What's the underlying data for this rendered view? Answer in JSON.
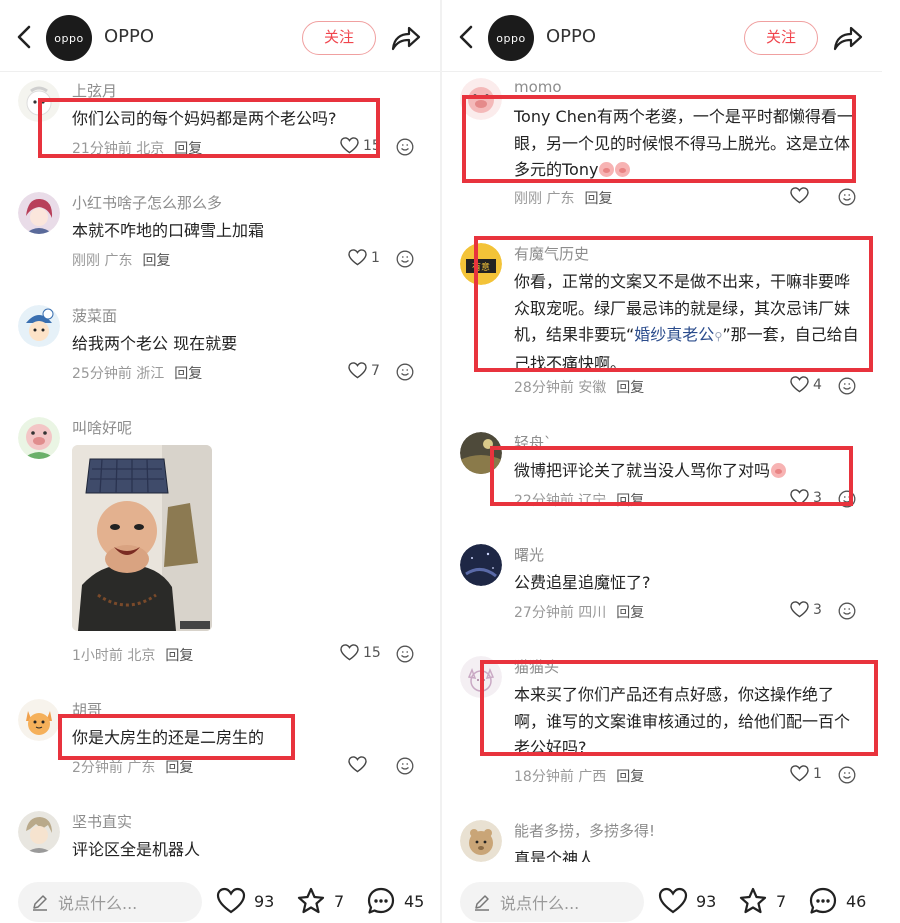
{
  "left": {
    "header": {
      "brand_logo_text": "oppo",
      "brand_name": "OPPO",
      "follow_label": "关注"
    },
    "comments": [
      {
        "name": "上弦月",
        "text": "你们公司的每个妈妈都是两个老公吗?",
        "time": "21分钟前",
        "location": "北京",
        "reply": "回复",
        "likes": "15"
      },
      {
        "name": "小红书啥子怎么那么多",
        "text": "本就不咋地的口碑雪上加霜",
        "time": "刚刚",
        "location": "广东",
        "reply": "回复",
        "likes": "1"
      },
      {
        "name": "菠菜面",
        "text": "给我两个老公 现在就要",
        "time": "25分钟前",
        "location": "浙江",
        "reply": "回复",
        "likes": "7"
      },
      {
        "name": "叫啥好呢",
        "text": "",
        "time": "1小时前",
        "location": "北京",
        "reply": "回复",
        "likes": "15"
      },
      {
        "name": "胡哥",
        "text": "你是大房生的还是二房生的",
        "time": "2分钟前",
        "location": "广东",
        "reply": "回复",
        "likes": ""
      },
      {
        "name": "坚书直实",
        "text": "评论区全是机器人"
      }
    ],
    "bottom": {
      "placeholder": "说点什么...",
      "likes": "93",
      "stars": "7",
      "comments": "45"
    }
  },
  "right": {
    "header": {
      "brand_logo_text": "oppo",
      "brand_name": "OPPO",
      "follow_label": "关注"
    },
    "comments": [
      {
        "name": "momo",
        "text": "Tony Chen有两个老婆，一个是平时都懒得看一眼，另一个见的时候恨不得马上脱光。这是立体多元的Tony",
        "time": "刚刚",
        "location": "广东",
        "reply": "回复",
        "likes": ""
      },
      {
        "name": "有魔气历史",
        "text_a": "你看，正常的文案又不是做不出来，干嘛非要哗众取宠呢。绿厂最忌讳的就是绿，其次忌讳厂妹机，结果非要玩“",
        "text_link": "婚纱真老公",
        "text_b": "”那一套，自己给自己找不痛快啊。",
        "time": "28分钟前",
        "location": "安徽",
        "reply": "回复",
        "likes": "4"
      },
      {
        "name": "轻舟`",
        "text": "微博把评论关了就当没人骂你了对吗",
        "time": "22分钟前",
        "location": "辽宁",
        "reply": "回复",
        "likes": "3"
      },
      {
        "name": "曙光",
        "text": "公费追星追魔怔了?",
        "time": "27分钟前",
        "location": "四川",
        "reply": "回复",
        "likes": "3"
      },
      {
        "name": "猫猫头",
        "text": "本来买了你们产品还有点好感，你这操作绝了啊，谁写的文案谁审核通过的，给他们配一百个老公好吗?",
        "time": "18分钟前",
        "location": "广西",
        "reply": "回复",
        "likes": "1"
      },
      {
        "name": "能者多捞，多捞多得!",
        "text": "真是个神人"
      }
    ],
    "bottom": {
      "placeholder": "说点什么...",
      "likes": "93",
      "stars": "7",
      "comments": "46"
    }
  }
}
